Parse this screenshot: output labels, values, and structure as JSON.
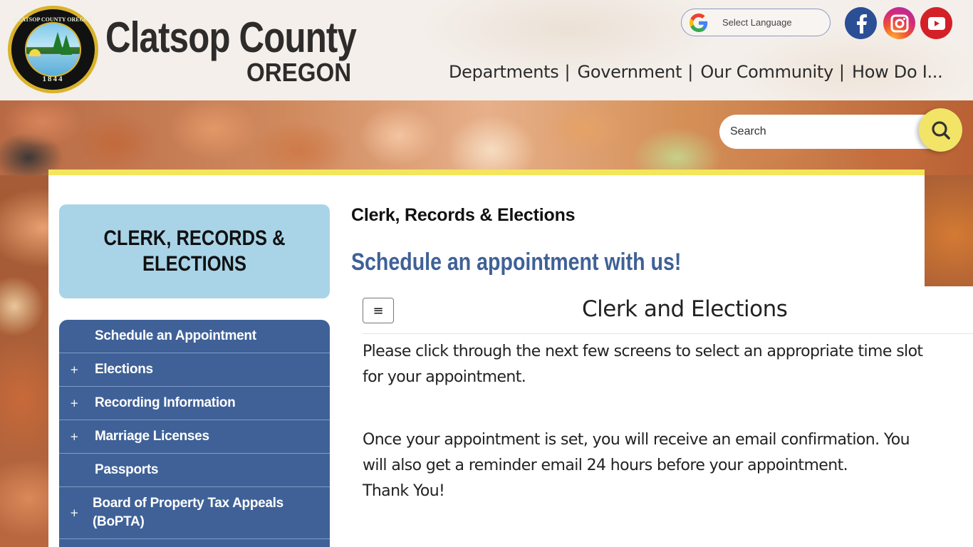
{
  "header": {
    "seal": {
      "top_text": "CLATSOP COUNTY OREGON",
      "year": "1844"
    },
    "brand_title": "Clatsop County",
    "brand_subtitle": "OREGON",
    "language_selector": {
      "label": "Select Language",
      "icon": "google-g-icon"
    },
    "social": [
      {
        "name": "Facebook",
        "icon": "facebook-icon",
        "color": "#2b4f95"
      },
      {
        "name": "Instagram",
        "icon": "instagram-icon",
        "color": "#d62a76"
      },
      {
        "name": "YouTube",
        "icon": "youtube-icon",
        "color": "#d42027"
      }
    ],
    "nav": [
      {
        "label": "Departments"
      },
      {
        "label": "Government"
      },
      {
        "label": "Our Community"
      },
      {
        "label": "How Do I..."
      }
    ],
    "nav_separator": "|"
  },
  "search": {
    "placeholder": "Search",
    "value": "",
    "button_icon": "search-icon",
    "button_color": "#f2e467"
  },
  "sidebar": {
    "department_title": "CLERK, RECORDS & ELECTIONS",
    "items": [
      {
        "label": "Schedule an Appointment",
        "expandable": false
      },
      {
        "label": "Elections",
        "expandable": true
      },
      {
        "label": "Recording Information",
        "expandable": true
      },
      {
        "label": "Marriage Licenses",
        "expandable": true
      },
      {
        "label": "Passports",
        "expandable": false
      },
      {
        "label": "Board of Property Tax Appeals (BoPTA)",
        "expandable": true
      }
    ],
    "expand_glyph": "+"
  },
  "main": {
    "page_heading": "Clerk, Records & Elections",
    "schedule_heading": "Schedule an appointment with us!",
    "embed": {
      "menu_glyph": "≡",
      "title": "Clerk and Elections",
      "paragraph1_line1": "Please click through the next few screens to select an appropriate time slot",
      "paragraph1_line2": "for your appointment.",
      "paragraph2_line1": "Once your appointment is set, you will receive an email confirmation. You",
      "paragraph2_line2": "will also get a reminder email 24 hours before your appointment.",
      "paragraph2_line3": "Thank You!"
    }
  },
  "colors": {
    "accent_yellow": "#f4e65a",
    "nav_blue": "#3f6197",
    "dept_box_blue": "#a9d4e8"
  }
}
